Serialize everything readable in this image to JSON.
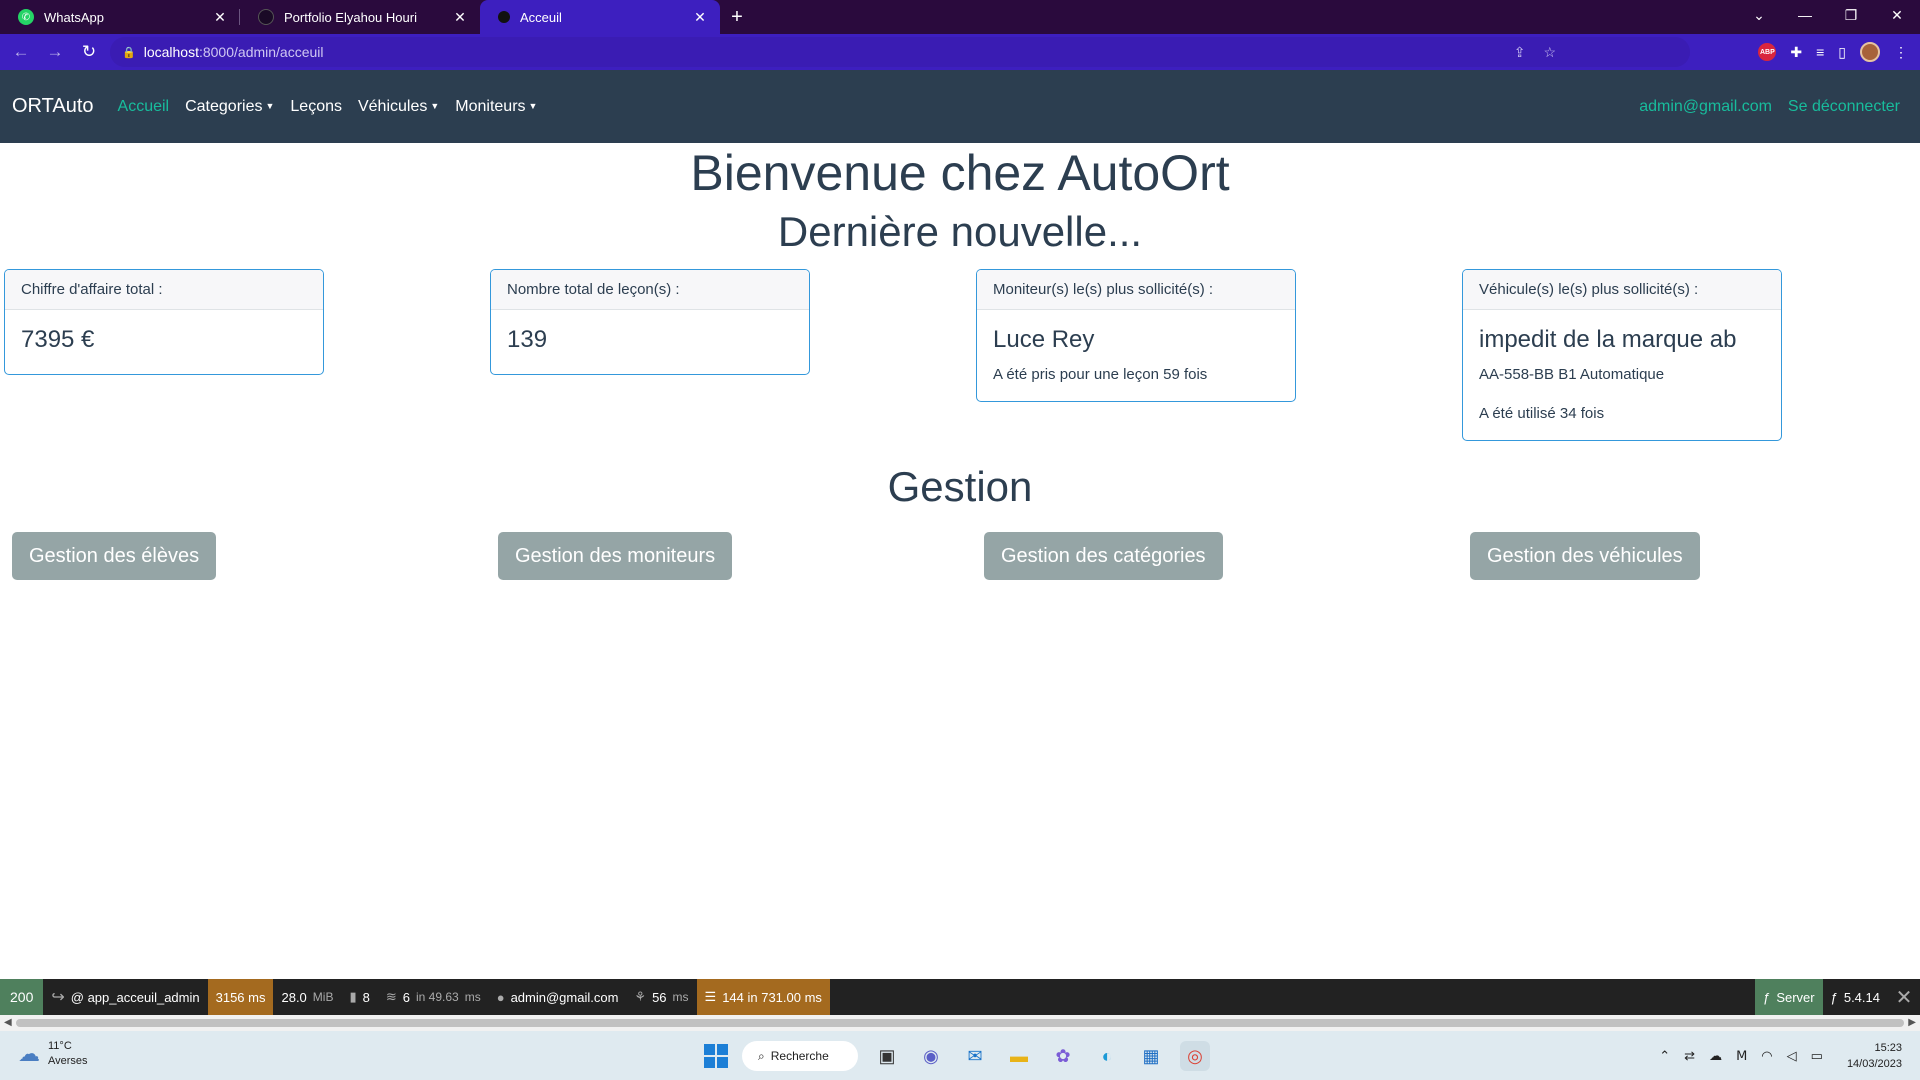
{
  "browser": {
    "tabs": [
      {
        "label": "WhatsApp",
        "icon": "whatsapp-icon"
      },
      {
        "label": "Portfolio Elyahou Houri",
        "icon": "globe-icon"
      },
      {
        "label": "Acceuil",
        "icon": "dot-icon",
        "active": true
      }
    ],
    "new_tab": "+",
    "url_host": "localhost",
    "url_port": ":8000",
    "url_path": "/admin/acceuil"
  },
  "navbar": {
    "brand": "ORTAuto",
    "items": [
      {
        "label": "Accueil",
        "active": true,
        "dropdown": false
      },
      {
        "label": "Categories",
        "dropdown": true
      },
      {
        "label": "Leçons",
        "dropdown": false
      },
      {
        "label": "Véhicules",
        "dropdown": true
      },
      {
        "label": "Moniteurs",
        "dropdown": true
      }
    ],
    "user_email": "admin@gmail.com",
    "logout": "Se déconnecter"
  },
  "page": {
    "title": "Bienvenue chez AutoOrt",
    "subtitle": "Dernière nouvelle...",
    "cards": [
      {
        "header": "Chiffre d'affaire total :",
        "value": "7395 €"
      },
      {
        "header": "Nombre total de leçon(s) :",
        "value": "139"
      },
      {
        "header": "Moniteur(s) le(s) plus sollicité(s) :",
        "value": "Luce Rey",
        "detail": "A été pris pour une leçon 59 fois"
      },
      {
        "header": "Véhicule(s) le(s) plus sollicité(s) :",
        "value": "impedit de la marque ab",
        "detail": "AA-558-BB B1 Automatique",
        "detail2": "A été utilisé 34 fois"
      }
    ],
    "gestion_title": "Gestion",
    "buttons": [
      "Gestion des élèves",
      "Gestion des moniteurs",
      "Gestion des catégories",
      "Gestion des véhicules"
    ]
  },
  "debug_toolbar": {
    "status": "200",
    "route": "@ app_acceuil_admin",
    "time": "3156 ms",
    "memory": "28.0",
    "memory_unit": "MiB",
    "security": "8",
    "cache": "6",
    "cache_in": "in 49.63",
    "cache_unit": "ms",
    "user": "admin@gmail.com",
    "twig": "56",
    "twig_unit": "ms",
    "db": "144 in 731.00 ms",
    "server": "Server",
    "version": "5.4.14"
  },
  "taskbar": {
    "temp": "11°C",
    "weather": "Averses",
    "search": "Recherche",
    "time": "15:23",
    "date": "14/03/2023"
  }
}
